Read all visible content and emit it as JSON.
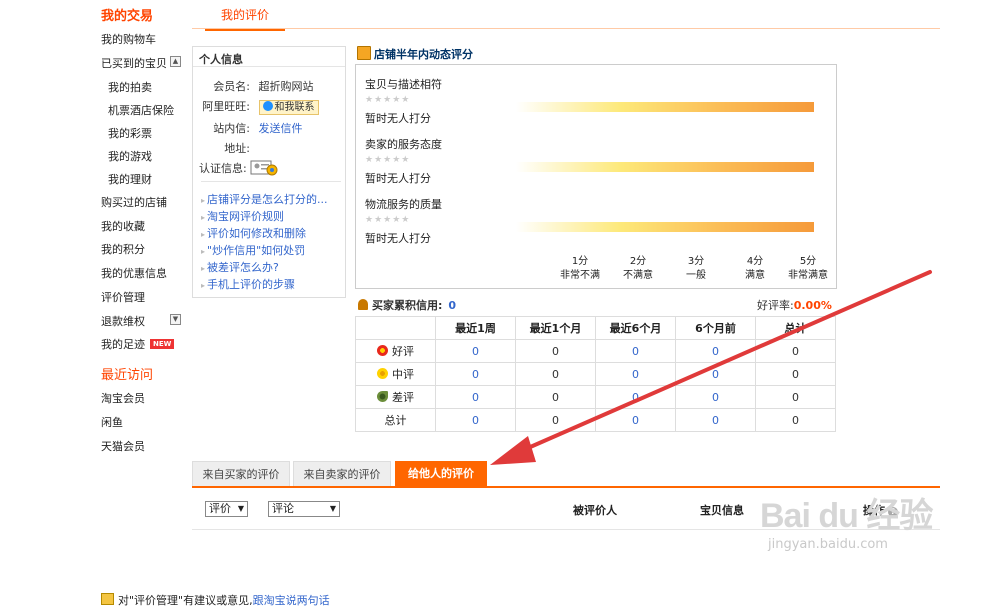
{
  "sidebar": {
    "trade_head": "我的交易",
    "items": [
      {
        "label": "我的购物车"
      },
      {
        "label": "已买到的宝贝"
      },
      {
        "label": "我的拍卖"
      },
      {
        "label": "机票酒店保险"
      },
      {
        "label": "我的彩票"
      },
      {
        "label": "我的游戏"
      },
      {
        "label": "我的理财"
      },
      {
        "label": "购买过的店铺"
      },
      {
        "label": "我的收藏"
      },
      {
        "label": "我的积分"
      },
      {
        "label": "我的优惠信息"
      },
      {
        "label": "评价管理"
      },
      {
        "label": "退款维权"
      },
      {
        "label": "我的足迹"
      }
    ],
    "new_badge": "NEW",
    "recent_head": "最近访问",
    "recent": [
      {
        "label": "淘宝会员"
      },
      {
        "label": "闲鱼"
      },
      {
        "label": "天猫会员"
      }
    ]
  },
  "top_tab": "我的评价",
  "info": {
    "title": "个人信息",
    "member_label": "会员名:",
    "member_value": "超折购网站",
    "wangwang_label": "阿里旺旺:",
    "wangwang_btn": "和我联系",
    "mail_label": "站内信:",
    "mail_value": "发送信件",
    "addr_label": "地址:",
    "cert_label": "认证信息:",
    "faq": [
      "店铺评分是怎么打分的...",
      "淘宝网评价规则",
      "评价如何修改和删除",
      "\"炒作信用\"如何处罚",
      "被差评怎么办?",
      "手机上评价的步骤"
    ]
  },
  "rating": {
    "title": "店铺半年内动态评分",
    "rows": [
      {
        "label": "宝贝与描述相符",
        "value": "暂时无人打分"
      },
      {
        "label": "卖家的服务态度",
        "value": "暂时无人打分"
      },
      {
        "label": "物流服务的质量",
        "value": "暂时无人打分"
      }
    ],
    "stars": "★★★★★",
    "scale": [
      {
        "score": "1分",
        "text": "非常不满"
      },
      {
        "score": "2分",
        "text": "不满意"
      },
      {
        "score": "3分",
        "text": "一般"
      },
      {
        "score": "4分",
        "text": "满意"
      },
      {
        "score": "5分",
        "text": "非常满意"
      }
    ]
  },
  "credit": {
    "label": "买家累积信用:",
    "value": "0",
    "good_rate_label": "好评率:",
    "good_rate_value": "0.00%"
  },
  "stats": {
    "headers": [
      "",
      "最近1周",
      "最近1个月",
      "最近6个月",
      "6个月前",
      "总计"
    ],
    "rows": [
      {
        "label": "好评",
        "values": [
          "0",
          "0",
          "0",
          "0",
          "0"
        ]
      },
      {
        "label": "中评",
        "values": [
          "0",
          "0",
          "0",
          "0",
          "0"
        ]
      },
      {
        "label": "差评",
        "values": [
          "0",
          "0",
          "0",
          "0",
          "0"
        ]
      },
      {
        "label": "总计",
        "values": [
          "0",
          "0",
          "0",
          "0",
          "0"
        ]
      }
    ]
  },
  "tabs": [
    {
      "label": "来自买家的评价"
    },
    {
      "label": "来自卖家的评价"
    },
    {
      "label": "给他人的评价"
    }
  ],
  "filters": {
    "select1": "评价",
    "select2": "评论"
  },
  "columns": {
    "rated_person": "被评价人",
    "item_info": "宝贝信息",
    "operation": "操作"
  },
  "feedback": {
    "prefix": "对\"评价管理\"有建议或意见,",
    "link": "跟淘宝说两句话"
  },
  "watermark": {
    "main": "Bai du 经验",
    "sub": "jingyan.baidu.com"
  },
  "colors": {
    "accent": "#ff6600",
    "link": "#3366cc",
    "arrow": "#e03a3a"
  }
}
